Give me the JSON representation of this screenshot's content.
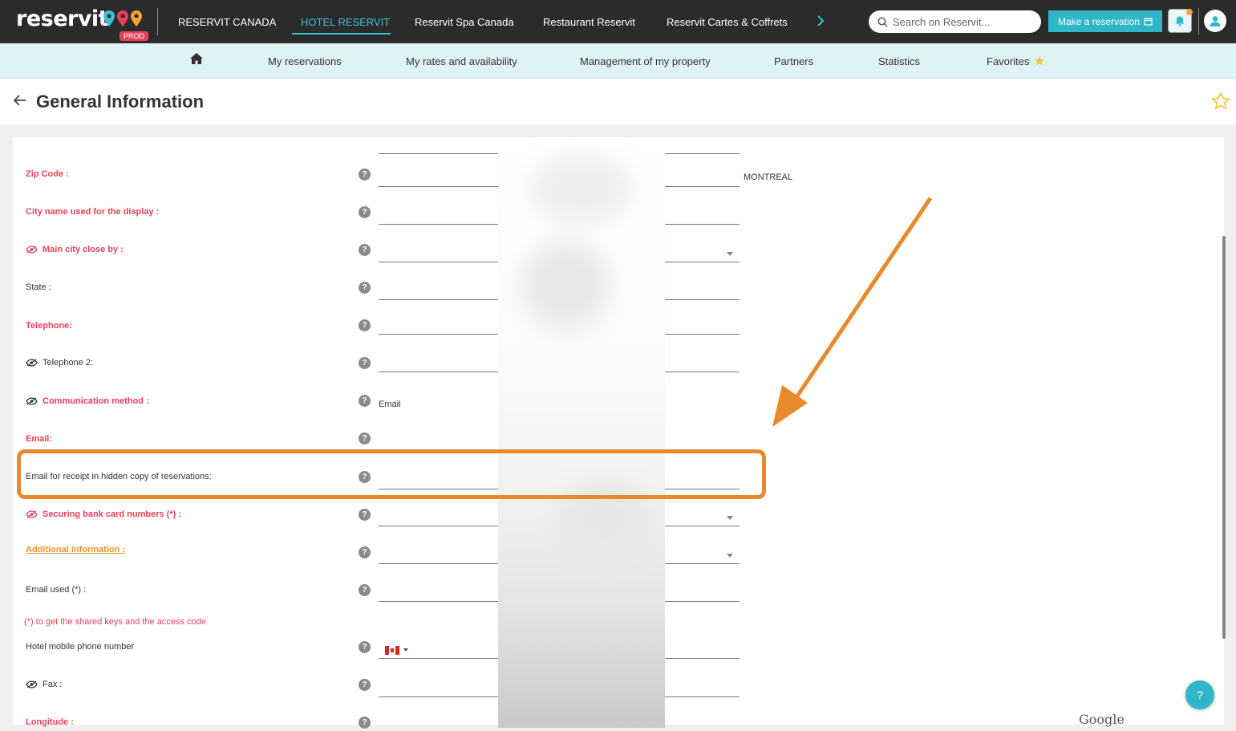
{
  "brand": {
    "logo_text": "reservit",
    "env_badge": "PROD"
  },
  "top_nav": {
    "items": [
      "RESERVIT CANADA",
      "HOTEL RESERVIT",
      "Reservit Spa Canada",
      "Restaurant Reservit",
      "Reservit Cartes & Coffrets"
    ],
    "active": "HOTEL RESERVIT",
    "search_placeholder": "Search on Reservit...",
    "make_reservation": "Make a reservation"
  },
  "sub_nav": {
    "items": [
      "My reservations",
      "My rates and availability",
      "Management of my property",
      "Partners",
      "Statistics",
      "Favorites"
    ]
  },
  "page": {
    "title": "General Information"
  },
  "form": {
    "fields": [
      {
        "label": "Zip Code :",
        "required": true
      },
      {
        "label": "City name used for the display :",
        "required": true
      },
      {
        "label": "Main city close by :",
        "required": true,
        "visibility_icon": "eye-off-icon"
      },
      {
        "label": "State :",
        "required": false
      },
      {
        "label": "Telephone:",
        "required": true
      },
      {
        "label": "Telephone 2:",
        "required": false,
        "visibility_icon": "eye-icon"
      },
      {
        "label": "Communication method :",
        "required": true,
        "visibility_icon": "eye-icon",
        "value": "Email"
      },
      {
        "label": "Email:",
        "required": true
      },
      {
        "label": "Email for receipt in hidden copy of reservations:",
        "required": false,
        "highlighted": true
      },
      {
        "label": "Securing bank card numbers (*) :",
        "required": true,
        "visibility_icon": "eye-off-icon"
      },
      {
        "label": "Additional information :",
        "style": "link"
      },
      {
        "label": "Email used (*) :",
        "required": false
      },
      {
        "label": "Hotel mobile phone number",
        "required": false
      },
      {
        "label": "Fax :",
        "required": false,
        "visibility_icon": "eye-icon"
      },
      {
        "label": "Longitude :",
        "required": true
      }
    ],
    "zip_city_value": "MONTREAL",
    "note": "(*) to get the shared keys and the access code"
  },
  "footer": {
    "map_credit": "Google",
    "help_button": "?"
  },
  "colors": {
    "accent": "#2fb6c7",
    "required": "#e8405a",
    "highlight": "#e8892b",
    "topbar": "#2b2b2b",
    "subnav": "#dff2f6"
  }
}
